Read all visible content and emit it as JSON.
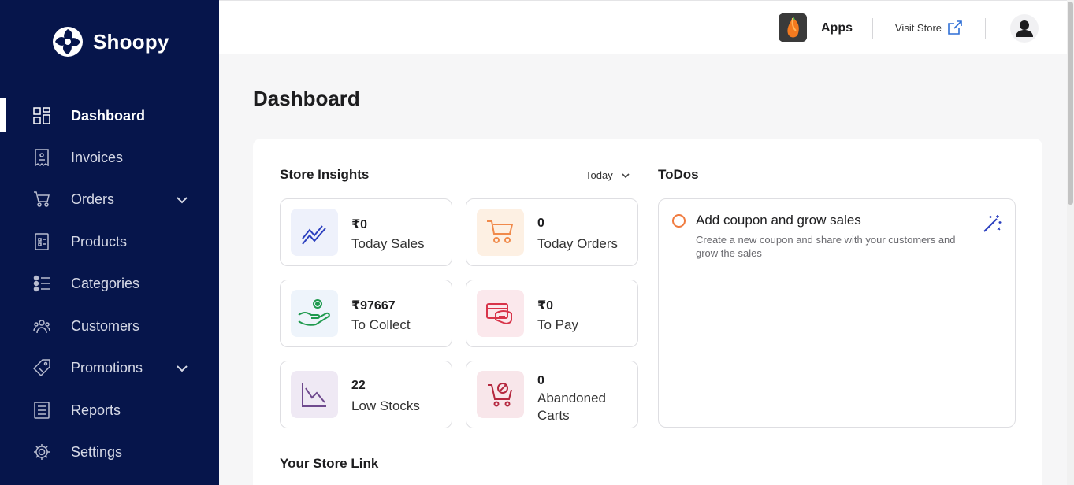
{
  "app": {
    "name": "Shoopy"
  },
  "sidebar": {
    "items": [
      {
        "label": "Dashboard",
        "icon": "dashboard-icon",
        "active": true
      },
      {
        "label": "Invoices",
        "icon": "invoice-icon"
      },
      {
        "label": "Orders",
        "icon": "cart-icon",
        "expandable": true
      },
      {
        "label": "Products",
        "icon": "product-icon"
      },
      {
        "label": "Categories",
        "icon": "categories-icon"
      },
      {
        "label": "Customers",
        "icon": "customers-icon"
      },
      {
        "label": "Promotions",
        "icon": "tag-icon",
        "expandable": true
      },
      {
        "label": "Reports",
        "icon": "reports-icon"
      },
      {
        "label": "Settings",
        "icon": "gear-icon"
      }
    ]
  },
  "header": {
    "apps_label": "Apps",
    "visit_store_label": "Visit Store"
  },
  "page": {
    "title": "Dashboard"
  },
  "insights": {
    "title": "Store Insights",
    "period": "Today",
    "stats": [
      {
        "value": "₹0",
        "label": "Today Sales",
        "icon": "trend-line-icon",
        "color": "#2b3fbf",
        "bg": "#eef1fb"
      },
      {
        "value": "0",
        "label": "Today Orders",
        "icon": "shopping-cart-icon",
        "color": "#f08a4b",
        "bg": "#fdf0e3"
      },
      {
        "value": "₹97667",
        "label": "To Collect",
        "icon": "hand-coin-icon",
        "color": "#1f9a4e",
        "bg": "#eef4fb"
      },
      {
        "value": "₹0",
        "label": "To Pay",
        "icon": "wallet-card-icon",
        "color": "#d8344a",
        "bg": "#fbe8ec"
      },
      {
        "value": "22",
        "label": "Low Stocks",
        "icon": "low-stock-chart-icon",
        "color": "#6f4a8e",
        "bg": "#efe9f4"
      },
      {
        "value": "0",
        "label": "Abandoned Carts",
        "icon": "cart-blocked-icon",
        "color": "#b5283f",
        "bg": "#f8e6ea"
      }
    ]
  },
  "todos": {
    "title": "ToDos",
    "items": [
      {
        "title": "Add coupon and grow sales",
        "description": "Create a new coupon and share with your customers and grow the sales"
      }
    ]
  },
  "store_link": {
    "title": "Your Store Link"
  },
  "colors": {
    "sidebar_bg": "#06154b",
    "accent": "#f07b3f",
    "page_bg": "#f6f6f7"
  }
}
